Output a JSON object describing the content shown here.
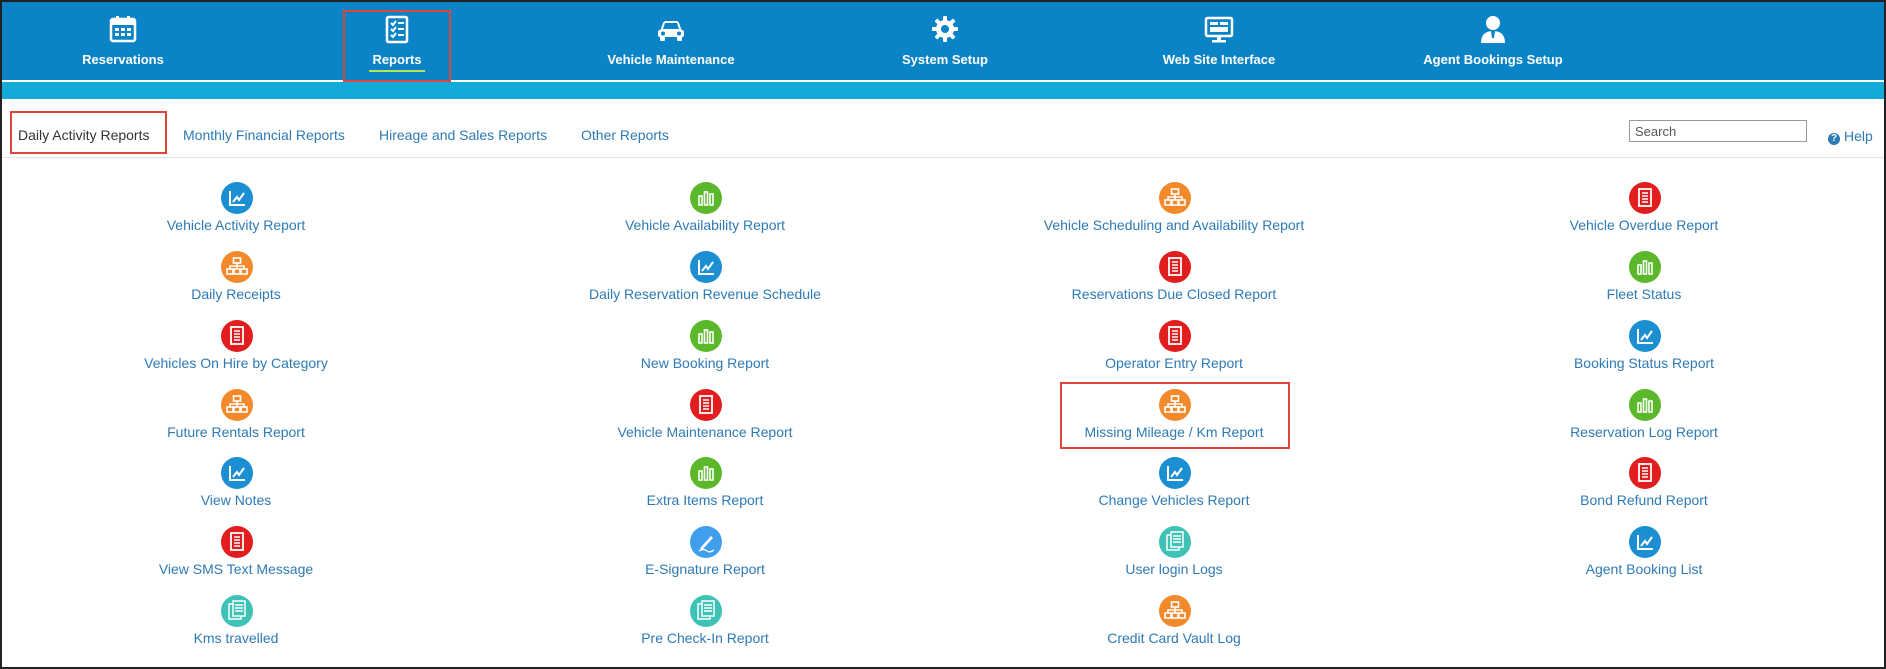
{
  "topnav": {
    "items": [
      {
        "label": "Reservations",
        "icon": "calendar-icon"
      },
      {
        "label": "Reports",
        "icon": "checklist-icon"
      },
      {
        "label": "Vehicle Maintenance",
        "icon": "car-icon"
      },
      {
        "label": "System Setup",
        "icon": "gear-icon"
      },
      {
        "label": "Web Site Interface",
        "icon": "monitor-icon"
      },
      {
        "label": "Agent Bookings Setup",
        "icon": "user-icon"
      }
    ],
    "active": "Reports"
  },
  "tabs": {
    "items": [
      {
        "label": "Daily Activity Reports"
      },
      {
        "label": "Monthly Financial Reports"
      },
      {
        "label": "Hireage and Sales Reports"
      },
      {
        "label": "Other Reports"
      }
    ],
    "active": "Daily Activity Reports"
  },
  "search": {
    "placeholder": "Search",
    "value": ""
  },
  "help": {
    "label": "Help"
  },
  "colors": {
    "nav": "#0a84c6",
    "subbar": "#13aad9",
    "link": "#2d7ab5",
    "highlight": "#e0443b",
    "blue": "#1b8fd2",
    "green": "#5ab82a",
    "orange": "#f28a2c",
    "red": "#e21d1d",
    "teal": "#3fc2b6"
  },
  "reports": {
    "col1": [
      {
        "label": "Vehicle Activity Report",
        "icon": "chart-line-icon",
        "color": "blue"
      },
      {
        "label": "Daily Receipts",
        "icon": "sitemap-icon",
        "color": "orange"
      },
      {
        "label": "Vehicles On Hire by Category",
        "icon": "document-icon",
        "color": "red"
      },
      {
        "label": "Future Rentals Report",
        "icon": "sitemap-icon",
        "color": "orange"
      },
      {
        "label": "View Notes",
        "icon": "chart-line-icon",
        "color": "blue"
      },
      {
        "label": "View SMS Text Message",
        "icon": "document-icon",
        "color": "red"
      },
      {
        "label": "Kms travelled",
        "icon": "documents-icon",
        "color": "teal"
      }
    ],
    "col2": [
      {
        "label": "Vehicle Availability Report",
        "icon": "bar-chart-icon",
        "color": "green"
      },
      {
        "label": "Daily Reservation Revenue Schedule",
        "icon": "chart-line-icon",
        "color": "blue"
      },
      {
        "label": "New Booking Report",
        "icon": "bar-chart-icon",
        "color": "green"
      },
      {
        "label": "Vehicle Maintenance Report",
        "icon": "document-icon",
        "color": "red"
      },
      {
        "label": "Extra Items Report",
        "icon": "bar-chart-icon",
        "color": "green"
      },
      {
        "label": "E-Signature Report",
        "icon": "pen-icon",
        "color": "lblue"
      },
      {
        "label": "Pre Check-In Report",
        "icon": "documents-icon",
        "color": "teal"
      }
    ],
    "col3": [
      {
        "label": "Vehicle Scheduling and Availability Report",
        "icon": "sitemap-icon",
        "color": "orange"
      },
      {
        "label": "Reservations Due Closed Report",
        "icon": "document-icon",
        "color": "red"
      },
      {
        "label": "Operator Entry Report",
        "icon": "document-icon",
        "color": "red"
      },
      {
        "label": "Missing Mileage / Km Report",
        "icon": "sitemap-icon",
        "color": "orange"
      },
      {
        "label": "Change Vehicles Report",
        "icon": "chart-line-icon",
        "color": "blue"
      },
      {
        "label": "User login Logs",
        "icon": "documents-icon",
        "color": "teal"
      },
      {
        "label": "Credit Card Vault Log",
        "icon": "sitemap-icon",
        "color": "orange"
      }
    ],
    "col4": [
      {
        "label": "Vehicle Overdue Report",
        "icon": "document-icon",
        "color": "red"
      },
      {
        "label": "Fleet Status",
        "icon": "bar-chart-icon",
        "color": "green"
      },
      {
        "label": "Booking Status Report",
        "icon": "chart-line-icon",
        "color": "blue"
      },
      {
        "label": "Reservation Log Report",
        "icon": "bar-chart-icon",
        "color": "green"
      },
      {
        "label": "Bond Refund Report",
        "icon": "document-icon",
        "color": "red"
      },
      {
        "label": "Agent Booking List",
        "icon": "chart-line-icon",
        "color": "blue"
      }
    ]
  }
}
